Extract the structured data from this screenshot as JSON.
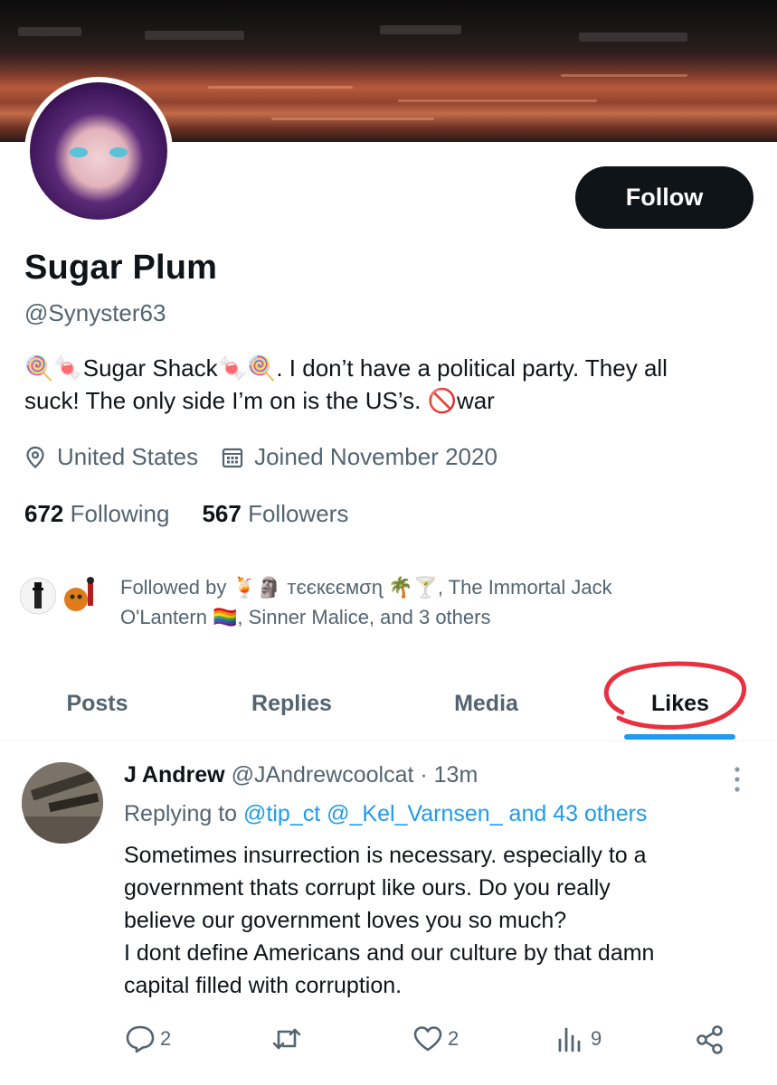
{
  "profile": {
    "name": "Sugar Plum",
    "handle": "@Synyster63",
    "follow_label": "Follow",
    "bio_line1": "🍭🍬Sugar Shack🍬🍭. I don’t have a political party. They all",
    "bio_line2": "suck! The only side I’m on is the US’s. 🚫war",
    "location": "United States",
    "joined": "Joined November 2020",
    "following_count": "672",
    "following_label": "Following",
    "followers_count": "567",
    "followers_label": "Followers",
    "followed_by_line1": "Followed by 🍹🗿 ᴛєєкєємσɳ 🌴🍸, The Immortal Jack",
    "followed_by_line2": "O'Lantern 🏳️‍🌈, Sinner Malice, and 3 others"
  },
  "tabs": [
    {
      "label": "Posts"
    },
    {
      "label": "Replies"
    },
    {
      "label": "Media"
    },
    {
      "label": "Likes",
      "active": true
    }
  ],
  "tweet": {
    "author_name": "J Andrew",
    "author_handle": "@JAndrewcoolcat",
    "time": "· 13m",
    "replying_prefix": "Replying to",
    "replying_to": "@tip_ct @_Kel_Varnsen_ and 43 others",
    "body": "Sometimes insurrection is necessary. especially to a\ngovernment thats corrupt like ours. Do you really\nbelieve our government loves you so much?\nI dont define Americans and our culture by that damn\ncapital filled with corruption.",
    "replies": "2",
    "retweets": "",
    "likes": "2",
    "views": "9"
  },
  "colors": {
    "accent": "#1d9bf0",
    "text": "#0f1419",
    "muted": "#536471",
    "annotation": "#e8303f"
  },
  "icons": [
    "location-icon",
    "calendar-icon",
    "reply-icon",
    "retweet-icon",
    "like-icon",
    "views-icon",
    "share-icon",
    "more-icon"
  ]
}
